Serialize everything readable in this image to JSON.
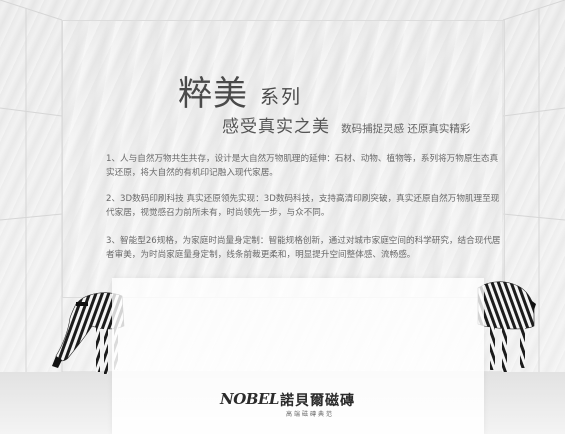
{
  "title": {
    "main": "粹美",
    "series": "系列"
  },
  "subtitle": {
    "main": "感受真实之美",
    "small": "数码捕捉灵感 还原真实精彩"
  },
  "paragraphs": [
    "1、人与自然万物共生共存，设计是大自然万物肌理的延伸：石材、动物、植物等，系列将万物原生态真实还原，将大自然的有机印记融入现代家居。",
    "2、3D数码印刷科技 真实还原领先实现：3D数码科技，支持高清印刷突破，真实还原自然万物肌理至现代家居，视觉感召力前所未有，时尚领先一步，与众不同。",
    "3、智能型26规格，为家庭时尚量身定制：智能规格创新，通过对城市家庭空间的科学研究，结合现代居者审美，为时尚家庭量身定制，线条前裁更柔和，明显提升空间整体感、流畅感。"
  ],
  "logo": {
    "mark": "NOBEL",
    "cn": "諾貝爾磁磚",
    "tagline": "高端磁磚典范"
  }
}
